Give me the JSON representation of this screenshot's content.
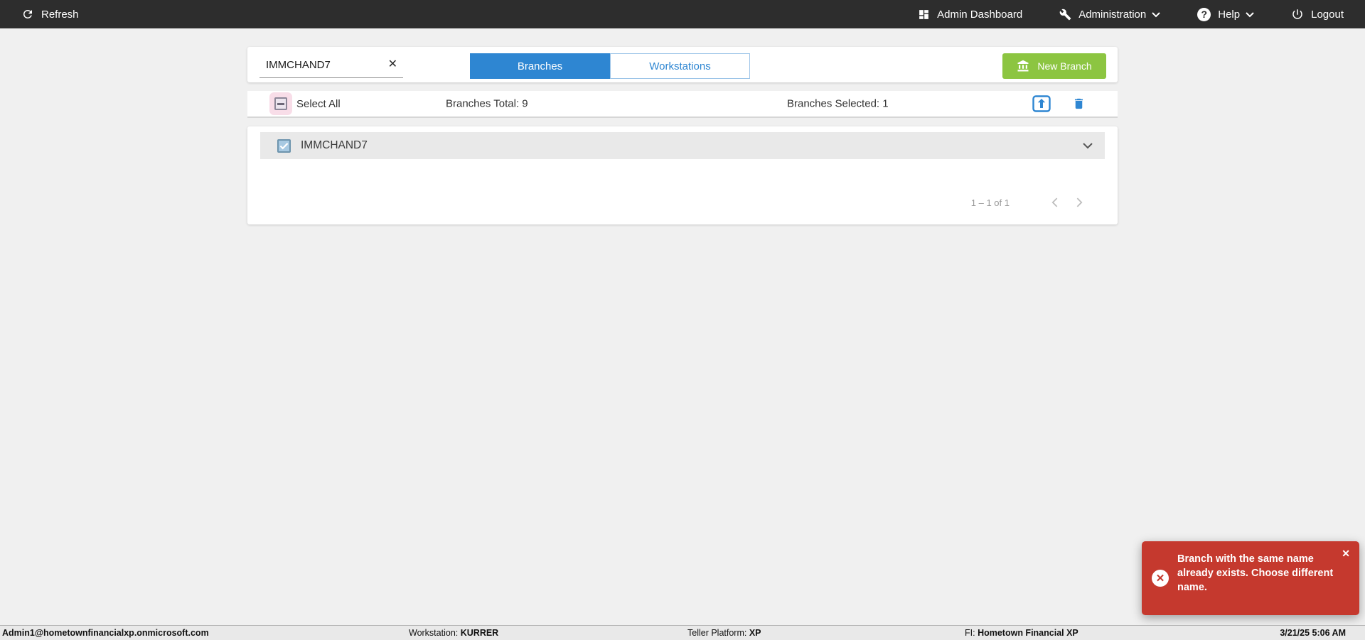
{
  "topbar": {
    "refresh_label": "Refresh",
    "admin_dashboard_label": "Admin Dashboard",
    "administration_label": "Administration",
    "help_label": "Help",
    "logout_label": "Logout"
  },
  "panel": {
    "search": {
      "value": "IMMCHAND7"
    },
    "tabs": [
      {
        "label": "Branches",
        "selected": true
      },
      {
        "label": "Workstations",
        "selected": false
      }
    ],
    "new_branch_label": "New Branch"
  },
  "list_header": {
    "select_all_label": "Select All",
    "total_label": "Branches Total:",
    "total_value": "9",
    "selected_label": "Branches Selected:",
    "selected_value": "1"
  },
  "list": {
    "items": [
      {
        "name": "IMMCHAND7",
        "checked": true
      }
    ]
  },
  "pagination": {
    "range": "1 – 1 of 1"
  },
  "toast": {
    "message": "Branch with the same name already exists. Choose different name."
  },
  "footer": {
    "user": "Admin1@hometownfinancialxp.onmicrosoft.com",
    "workstation_label": "Workstation:",
    "workstation_value": "KURRER",
    "teller_platform_label": "Teller Platform:",
    "teller_platform_value": "XP",
    "fi_label": "FI:",
    "fi_value": "Hometown Financial XP",
    "datetime": "3/21/25 5:06 AM"
  },
  "icons": {
    "search_clear": "✕",
    "toast_close": "✕",
    "help_glyph": "?"
  },
  "colors": {
    "accent_blue": "#2e86d2",
    "button_green": "#8cc541",
    "toast_red": "#c5392e",
    "topbar_bg": "#2d2d2d"
  }
}
